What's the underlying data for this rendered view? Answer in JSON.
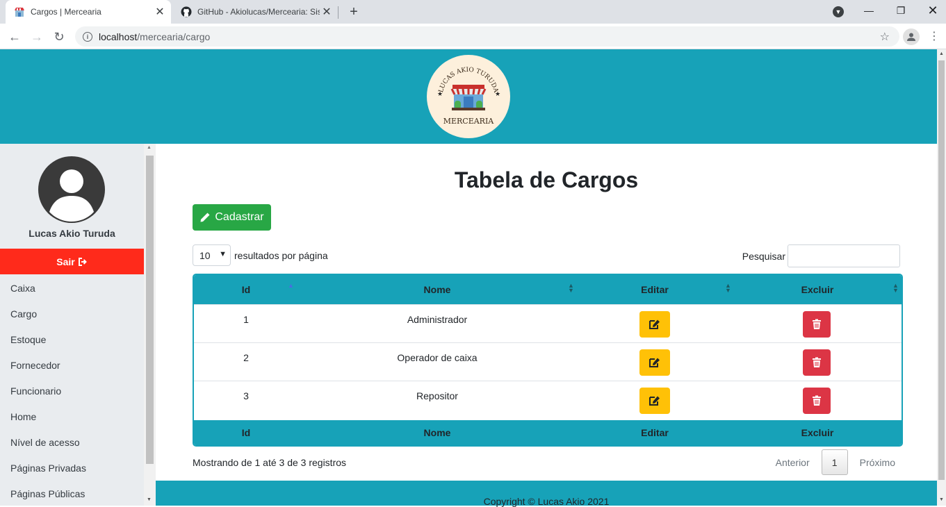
{
  "browser": {
    "tabs": [
      {
        "title": "Cargos | Mercearia",
        "active": true
      },
      {
        "title": "GitHub - Akiolucas/Mercearia: Sis",
        "active": false
      }
    ],
    "url_host": "localhost",
    "url_path": "/mercearia/cargo"
  },
  "logo": {
    "top_text": "LUCAS AKIO TURUDA",
    "bottom_text": "MERCEARIA"
  },
  "sidebar": {
    "user_name": "Lucas Akio Turuda",
    "logout_label": "Sair",
    "items": [
      "Caixa",
      "Cargo",
      "Estoque",
      "Fornecedor",
      "Funcionario",
      "Home",
      "Nível de acesso",
      "Páginas Privadas",
      "Páginas Públicas"
    ]
  },
  "main": {
    "title": "Tabela de Cargos",
    "add_button": "Cadastrar",
    "page_length": "10",
    "page_length_label": "resultados por página",
    "search_label": "Pesquisar",
    "columns": [
      "Id",
      "Nome",
      "Editar",
      "Excluir"
    ],
    "rows": [
      {
        "id": "1",
        "nome": "Administrador"
      },
      {
        "id": "2",
        "nome": "Operador de caixa"
      },
      {
        "id": "3",
        "nome": "Repositor"
      }
    ],
    "info": "Mostrando de 1 até 3 de 3 registros",
    "pagination": {
      "prev": "Anterior",
      "current": "1",
      "next": "Próximo"
    }
  },
  "footer": {
    "text": "Copyright © Lucas Akio 2021"
  },
  "colors": {
    "header": "#17a2b8",
    "logout": "#ff2a1b",
    "add": "#28a745",
    "edit": "#ffc107",
    "delete": "#dc3545"
  }
}
